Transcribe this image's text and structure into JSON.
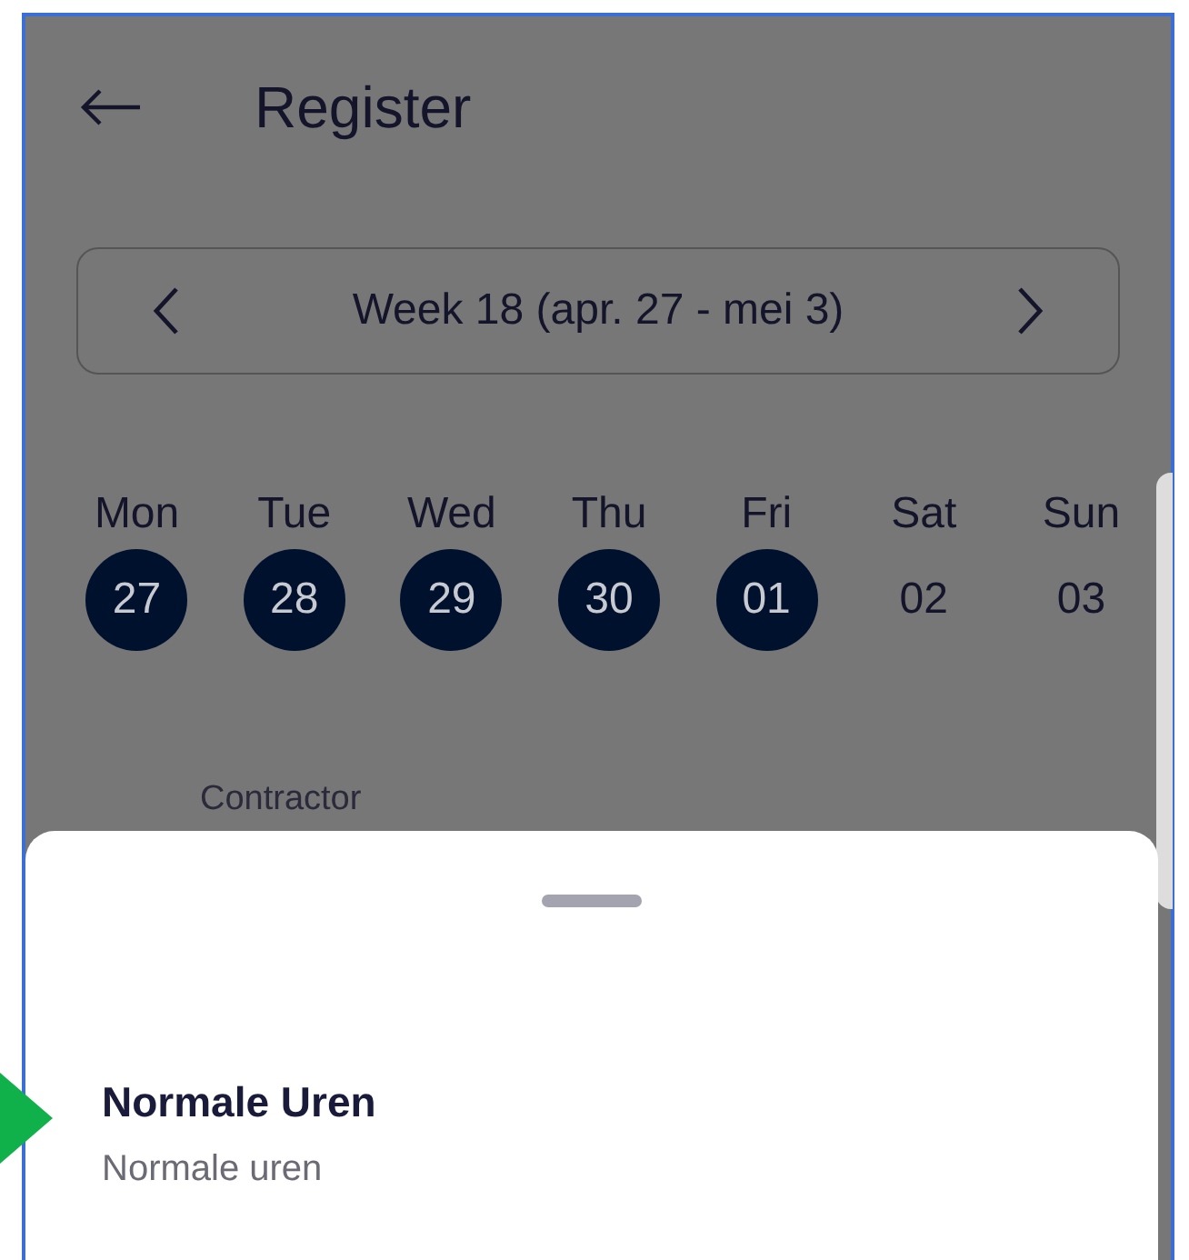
{
  "header": {
    "title": "Register"
  },
  "week_selector": {
    "label": "Week 18 (apr. 27 - mei 3)"
  },
  "days": [
    {
      "weekday": "Mon",
      "date": "27",
      "selected": true
    },
    {
      "weekday": "Tue",
      "date": "28",
      "selected": true
    },
    {
      "weekday": "Wed",
      "date": "29",
      "selected": true
    },
    {
      "weekday": "Thu",
      "date": "30",
      "selected": true
    },
    {
      "weekday": "Fri",
      "date": "01",
      "selected": true
    },
    {
      "weekday": "Sat",
      "date": "02",
      "selected": false
    },
    {
      "weekday": "Sun",
      "date": "03",
      "selected": false
    }
  ],
  "contractor": {
    "label": "Contractor"
  },
  "bottom_sheet": {
    "items": [
      {
        "title": "Normale Uren",
        "subtitle": "Normale uren"
      }
    ]
  }
}
